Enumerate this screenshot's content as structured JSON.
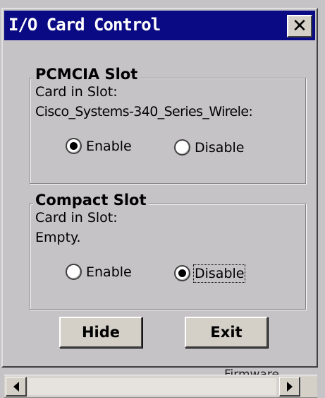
{
  "dialog": {
    "title": "I/O Card Control",
    "close_glyph": "✕"
  },
  "pcmcia": {
    "title": "PCMCIA Slot",
    "card_label": "Card in Slot:",
    "card_value": "Cisco_Systems-340_Series_Wirele:",
    "enable_label": "Enable",
    "disable_label": "Disable",
    "selected": "Enable"
  },
  "compact": {
    "title": "Compact Slot",
    "card_label": "Card in Slot:",
    "card_value": "Empty.",
    "enable_label": "Enable",
    "disable_label": "Disable",
    "selected": "Disable"
  },
  "buttons": {
    "hide": "Hide",
    "exit": "Exit"
  },
  "background": {
    "partial_label": "Firmware"
  }
}
